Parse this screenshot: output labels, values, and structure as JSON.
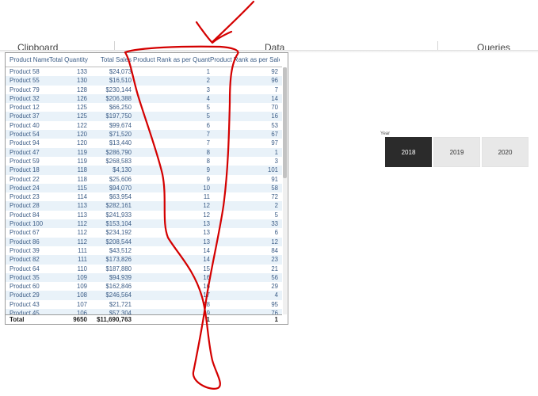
{
  "ribbon": {
    "groups": [
      "Clipboard",
      "Data",
      "Queries"
    ]
  },
  "table": {
    "columns": [
      "Product Name",
      "Total Quantity",
      "Total Sales",
      "Product Rank as per Quantity",
      "Product Rank as per Sales"
    ],
    "rows": [
      [
        "Product 58",
        "133",
        "$24,073",
        "1",
        "92"
      ],
      [
        "Product 55",
        "130",
        "$16,510",
        "2",
        "96"
      ],
      [
        "Product 79",
        "128",
        "$230,144",
        "3",
        "7"
      ],
      [
        "Product 32",
        "126",
        "$206,388",
        "4",
        "14"
      ],
      [
        "Product 12",
        "125",
        "$66,250",
        "5",
        "70"
      ],
      [
        "Product 37",
        "125",
        "$197,750",
        "5",
        "16"
      ],
      [
        "Product 40",
        "122",
        "$99,674",
        "6",
        "53"
      ],
      [
        "Product 54",
        "120",
        "$71,520",
        "7",
        "67"
      ],
      [
        "Product 94",
        "120",
        "$13,440",
        "7",
        "97"
      ],
      [
        "Product 47",
        "119",
        "$286,790",
        "8",
        "1"
      ],
      [
        "Product 59",
        "119",
        "$268,583",
        "8",
        "3"
      ],
      [
        "Product 18",
        "118",
        "$4,130",
        "9",
        "101"
      ],
      [
        "Product 22",
        "118",
        "$25,606",
        "9",
        "91"
      ],
      [
        "Product 24",
        "115",
        "$94,070",
        "10",
        "58"
      ],
      [
        "Product 23",
        "114",
        "$63,954",
        "11",
        "72"
      ],
      [
        "Product 28",
        "113",
        "$282,161",
        "12",
        "2"
      ],
      [
        "Product 84",
        "113",
        "$241,933",
        "12",
        "5"
      ],
      [
        "Product 100",
        "112",
        "$153,104",
        "13",
        "33"
      ],
      [
        "Product 67",
        "112",
        "$234,192",
        "13",
        "6"
      ],
      [
        "Product 86",
        "112",
        "$208,544",
        "13",
        "12"
      ],
      [
        "Product 39",
        "111",
        "$43,512",
        "14",
        "84"
      ],
      [
        "Product 82",
        "111",
        "$173,826",
        "14",
        "23"
      ],
      [
        "Product 64",
        "110",
        "$187,880",
        "15",
        "21"
      ],
      [
        "Product 35",
        "109",
        "$94,939",
        "16",
        "56"
      ],
      [
        "Product 60",
        "109",
        "$162,846",
        "16",
        "29"
      ],
      [
        "Product 29",
        "108",
        "$246,564",
        "17",
        "4"
      ],
      [
        "Product 43",
        "107",
        "$21,721",
        "18",
        "95"
      ],
      [
        "Product 45",
        "106",
        "$57,304",
        "19",
        "76"
      ]
    ],
    "total": [
      "Total",
      "9650",
      "$11,690,763",
      "1",
      "1"
    ]
  },
  "slicer": {
    "title": "Year",
    "options": [
      "2018",
      "2019",
      "2020"
    ],
    "selected": "2018"
  },
  "colors": {
    "annotation": "#d40000",
    "header_text": "#3b5c86",
    "row_band": "#e9f2f9",
    "slicer_selected": "#2b2b2b"
  }
}
